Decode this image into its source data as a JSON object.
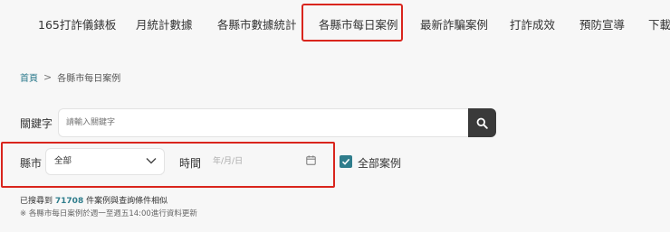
{
  "nav": {
    "tabs": [
      {
        "label": "165打詐儀錶板"
      },
      {
        "label": "月統計數據"
      },
      {
        "label": "各縣市數據統計"
      },
      {
        "label": "各縣市每日案例"
      },
      {
        "label": "最新詐騙案例"
      },
      {
        "label": "打詐成效"
      },
      {
        "label": "預防宣導"
      },
      {
        "label": "下載"
      }
    ],
    "active_index": 3
  },
  "breadcrumb": {
    "home": "首頁",
    "separator": ">",
    "current": "各縣市每日案例"
  },
  "search": {
    "label": "關鍵字",
    "placeholder": "請輸入關鍵字",
    "button_icon": "search-icon"
  },
  "filters": {
    "county_label": "縣市",
    "county_value": "全部",
    "time_label": "時間",
    "date_placeholder": "年/月/日",
    "all_cases_label": "全部案例",
    "all_cases_checked": true
  },
  "result": {
    "prefix": "已搜尋到",
    "count": "71708",
    "suffix": "件案例與查詢條件相似",
    "note": "※ 各縣市每日案例於週一至週五14:00進行資料更新"
  },
  "colors": {
    "accent": "#2f7d8c",
    "highlight_border": "#d9251d",
    "search_button": "#3a3a3a"
  }
}
